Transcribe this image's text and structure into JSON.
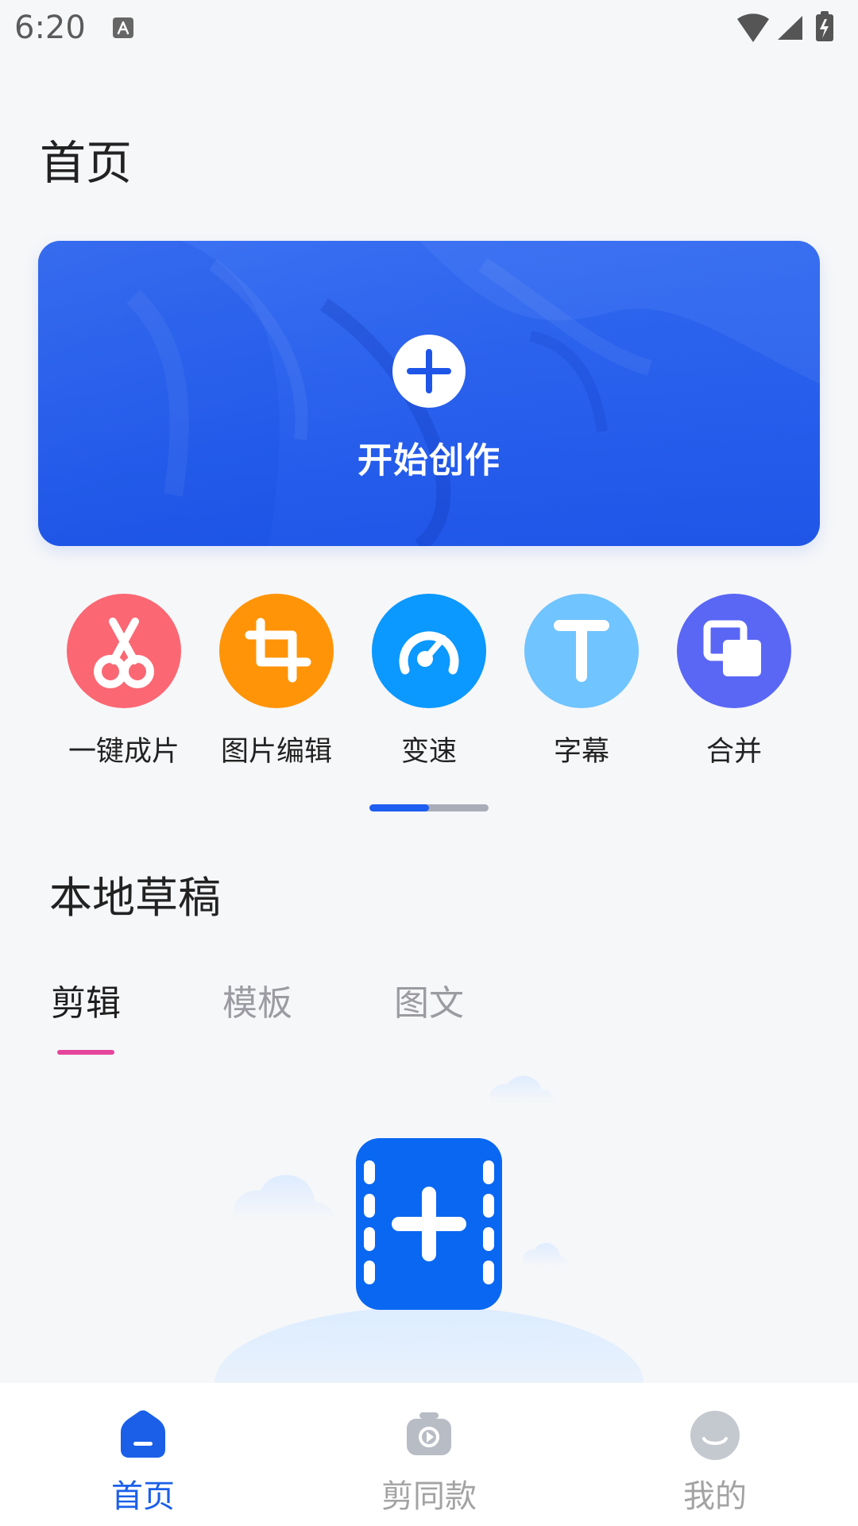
{
  "status_bar": {
    "time": "6:20",
    "icons": [
      "a-icon",
      "wifi-icon",
      "signal-icon",
      "battery-icon"
    ]
  },
  "header": {
    "title": "首页"
  },
  "hero": {
    "label": "开始创作",
    "icon": "plus-icon",
    "accent": "#2e66ee"
  },
  "tools": [
    {
      "label": "一键成片",
      "icon": "scissors-icon",
      "color": "#fb6773"
    },
    {
      "label": "图片编辑",
      "icon": "crop-icon",
      "color": "#ff9408"
    },
    {
      "label": "变速",
      "icon": "speedometer-icon",
      "color": "#0b98ff"
    },
    {
      "label": "字幕",
      "icon": "text-icon",
      "color": "#70c4ff"
    },
    {
      "label": "合并",
      "icon": "merge-icon",
      "color": "#5a67f5"
    }
  ],
  "pager": {
    "progress": 0.5
  },
  "drafts": {
    "title": "本地草稿",
    "tabs": [
      "剪辑",
      "模板",
      "图文"
    ],
    "active_tab": "剪辑",
    "indicator_color": "#e5459c"
  },
  "empty_state": {
    "icon": "add-video-icon",
    "accent": "#0a67f2"
  },
  "bottom_nav": {
    "items": [
      {
        "label": "首页",
        "icon": "home-icon",
        "active": true
      },
      {
        "label": "剪同款",
        "icon": "template-video-icon",
        "active": false
      },
      {
        "label": "我的",
        "icon": "profile-icon",
        "active": false
      }
    ]
  },
  "colors": {
    "background": "#f6f7f9",
    "active_nav": "#1b5fe9",
    "inactive_text": "#9b9ba1"
  }
}
